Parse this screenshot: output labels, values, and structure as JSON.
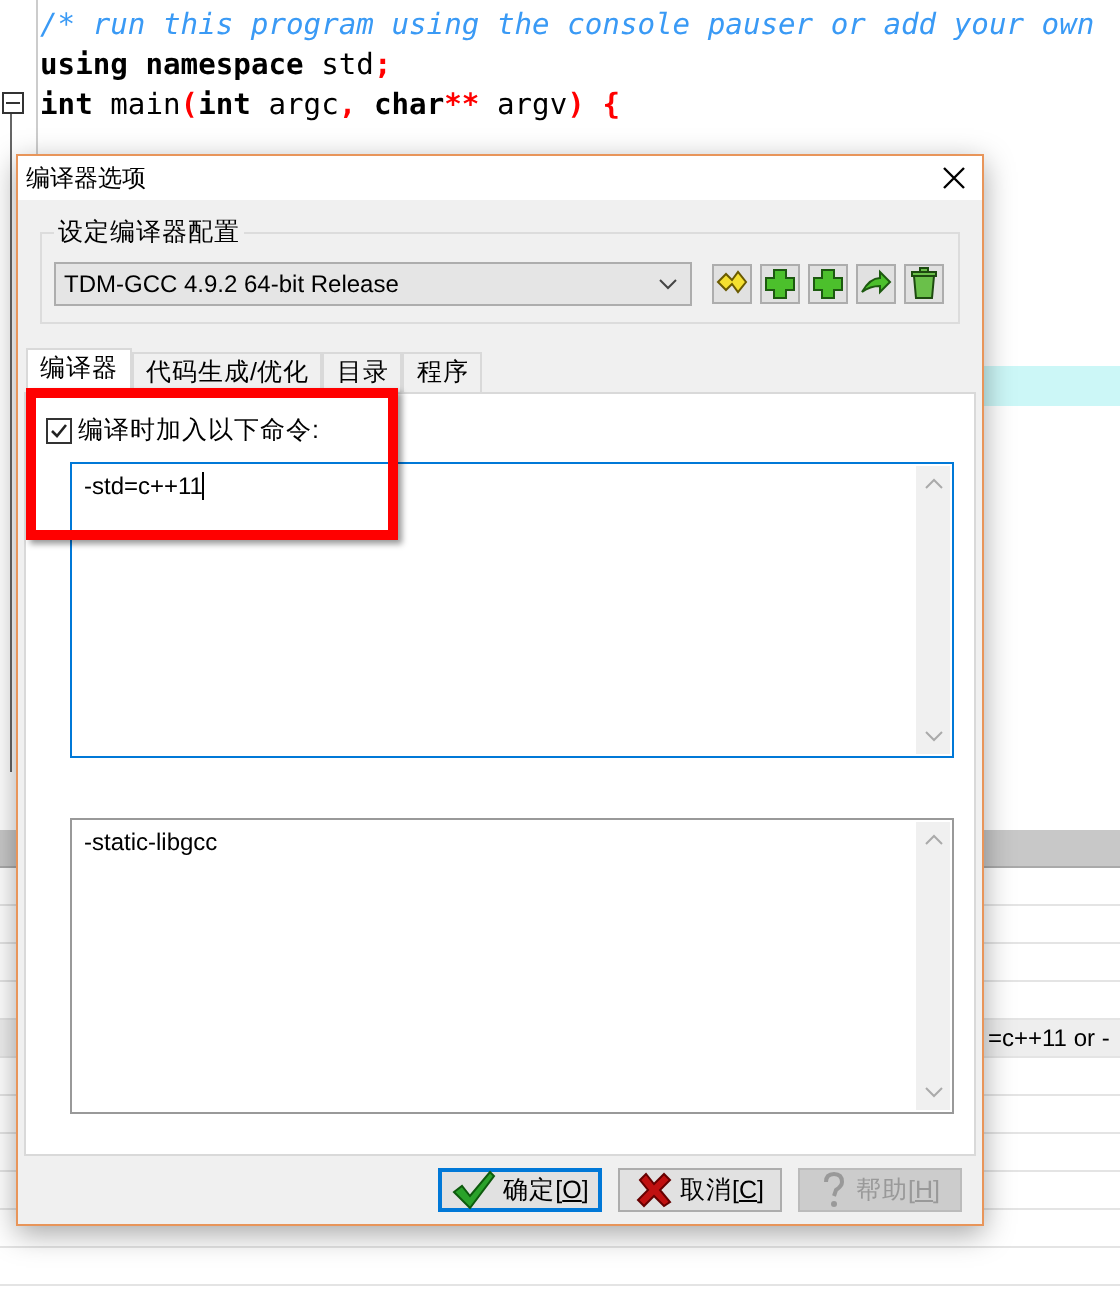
{
  "editor": {
    "code_lines": [
      [
        {
          "kind": "comment",
          "text": "/* run this program using the console pauser or add your own"
        }
      ],
      [
        {
          "kind": "keyword",
          "text": "using"
        },
        {
          "kind": "keyword",
          "text": " namespace"
        },
        {
          "kind": "plain",
          "text": " std"
        },
        {
          "kind": "punct",
          "text": ";"
        }
      ],
      [
        {
          "kind": "keyword",
          "text": "int"
        },
        {
          "kind": "plain",
          "text": " main"
        },
        {
          "kind": "punct",
          "text": "("
        },
        {
          "kind": "keyword",
          "text": "int"
        },
        {
          "kind": "plain",
          "text": " argc"
        },
        {
          "kind": "punct",
          "text": ","
        },
        {
          "kind": "keyword",
          "text": " char"
        },
        {
          "kind": "punct",
          "text": "**"
        },
        {
          "kind": "plain",
          "text": " argv"
        },
        {
          "kind": "punct",
          "text": ")"
        },
        {
          "kind": "punct",
          "text": " {"
        }
      ]
    ],
    "log_text": "=c++11 or -"
  },
  "dialog": {
    "title": "编译器选项",
    "config_group": {
      "label": "设定编译器配置",
      "selected_compiler": "TDM-GCC 4.9.2 64-bit Release"
    },
    "tabs": [
      {
        "label": "编译器",
        "selected": true
      },
      {
        "label": "代码生成/优化",
        "selected": false
      },
      {
        "label": "目录",
        "selected": false
      },
      {
        "label": "程序",
        "selected": false
      }
    ],
    "compile_commands": {
      "label": "编译时加入以下命令:",
      "checked": true,
      "value": "-std=c++11"
    },
    "linker_commands": {
      "value": "-static-libgcc"
    },
    "buttons": [
      {
        "kind": "ok",
        "before": "确定[",
        "hotkey": "O",
        "after": "]",
        "disabled": false,
        "default": true
      },
      {
        "kind": "cancel",
        "before": "取消[",
        "hotkey": "C",
        "after": "]",
        "disabled": false,
        "default": false
      },
      {
        "kind": "help",
        "before": "帮助[",
        "hotkey": "H",
        "after": "]",
        "disabled": true,
        "default": false
      }
    ]
  }
}
